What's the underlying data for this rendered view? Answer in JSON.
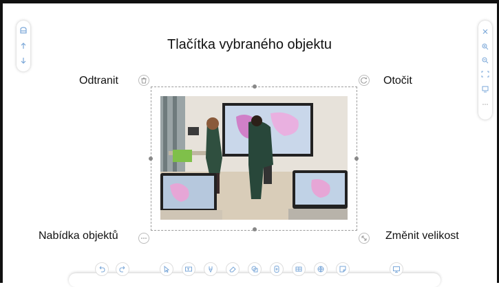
{
  "page": {
    "title": "Tlačítka vybraného objektu"
  },
  "callouts": {
    "delete": "Odtranit",
    "rotate": "Otočit",
    "object_menu": "Nabídka objektů",
    "resize": "Změnit velikost"
  },
  "left_toolbar": {
    "icons": [
      "panel-icon",
      "arrow-up-icon",
      "arrow-down-icon"
    ]
  },
  "right_toolbar": {
    "icons": [
      "close-icon",
      "zoom-in-icon",
      "zoom-out-icon",
      "fit-icon",
      "screen-icon",
      "more-icon"
    ]
  },
  "bottom_toolbar": {
    "icons": [
      "undo-icon",
      "redo-icon",
      "select-icon",
      "text-icon",
      "pen-icon",
      "eraser-icon",
      "shapes-icon",
      "insert-icon",
      "table-icon",
      "globe-icon",
      "note-icon",
      "present-icon"
    ]
  },
  "photo": {
    "subject": "classroom-interactive-display"
  },
  "colors": {
    "accent": "#7aa7d8",
    "frame": "#111111",
    "handle": "#888888"
  }
}
